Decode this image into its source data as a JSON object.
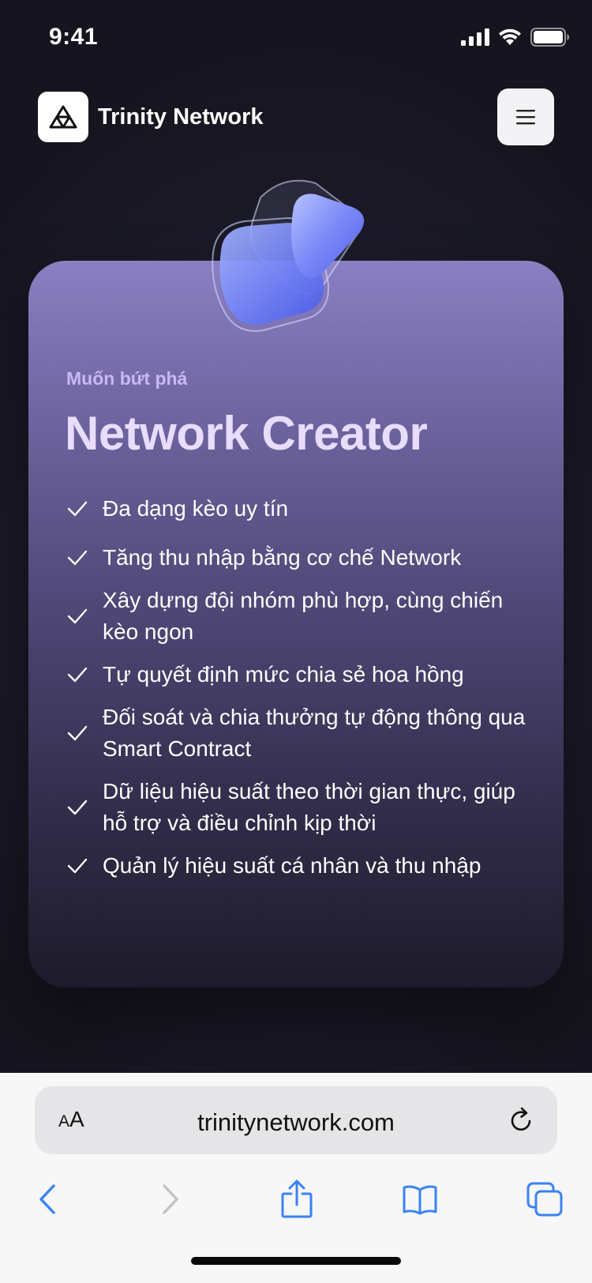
{
  "status_bar": {
    "time": "9:41",
    "icons": [
      "cellular-signal-icon",
      "wifi-icon",
      "battery-icon"
    ]
  },
  "header": {
    "brand": "Trinity Network",
    "logo_icon": "trinity-logo",
    "menu_icon": "hamburger-menu-icon"
  },
  "card": {
    "subtitle": "Muốn bứt phá",
    "title": "Network Creator",
    "features": [
      "Đa dạng kèo uy tín",
      "Tăng thu nhập bằng cơ chế Network",
      "Xây dựng đội nhóm phù hợp, cùng chiến kèo ngon",
      "Tự quyết định mức chia sẻ hoa hồng",
      "Đối soát và chia thưởng tự động thông qua Smart Contract",
      "Dữ liệu hiệu suất theo thời gian thực, giúp hỗ trợ và điều chỉnh kịp thời",
      "Quản lý hiệu suất cá nhân và thu nhập"
    ]
  },
  "browser": {
    "aa_big": "A",
    "aa_small": "A",
    "url": "trinitynetwork.com",
    "toolbar_icons": [
      "back-icon",
      "forward-icon",
      "share-icon",
      "bookmarks-icon",
      "tabs-icon"
    ]
  },
  "colors": {
    "accent": "#3b82f6",
    "card_top": "#8a7fc2",
    "title": "#e8dcff"
  }
}
